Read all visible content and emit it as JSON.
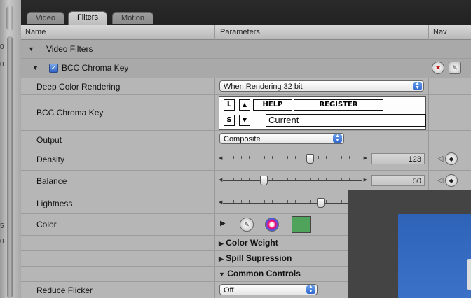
{
  "tabs": [
    "Video",
    "Filters",
    "Motion"
  ],
  "active_tab": "Filters",
  "columns": {
    "name": "Name",
    "parameters": "Parameters",
    "nav": "Nav"
  },
  "groups": {
    "video_filters": "Video Filters",
    "bcc_chroma_key": "BCC Chroma Key"
  },
  "params": {
    "deep_color": {
      "label": "Deep Color Rendering",
      "value": "When Rendering 32 bit"
    },
    "bcc_chroma_key": {
      "label": "BCC Chroma Key",
      "btn_l": "L",
      "btn_up": "▲",
      "btn_help": "HELP",
      "btn_register": "REGISTER",
      "btn_s": "S",
      "btn_down": "▼",
      "preset_value": "Current"
    },
    "output": {
      "label": "Output",
      "value": "Composite"
    },
    "density": {
      "label": "Density",
      "value": "123",
      "slider_fraction": 0.62
    },
    "balance": {
      "label": "Balance",
      "value": "50",
      "slider_fraction": 0.27
    },
    "lightness": {
      "label": "Lightness",
      "slider_fraction": 0.7
    },
    "color": {
      "label": "Color",
      "swatch": "#4fa35a"
    },
    "reduce_flicker": {
      "label": "Reduce Flicker",
      "value": "Off"
    }
  },
  "sections": {
    "color_weight": "Color Weight",
    "spill": "Spill Supression",
    "common": "Common Controls"
  },
  "left_edge_numbers": [
    "0",
    "0",
    "5",
    "0"
  ],
  "colors": {
    "tab_bar": "#222222",
    "panel": "#b6b6b6",
    "accent_blue": "#2f66cf",
    "overlay_blue": "#2e63b8"
  }
}
